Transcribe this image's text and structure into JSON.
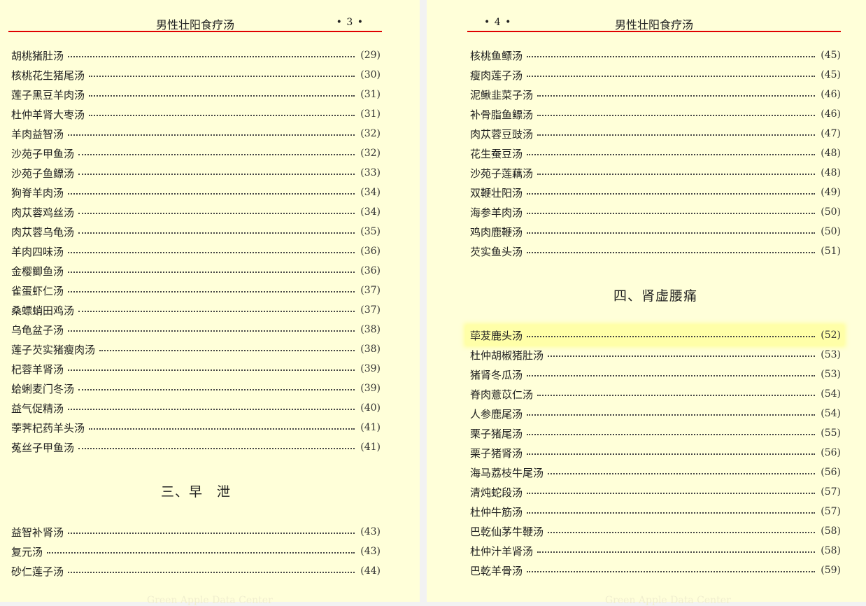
{
  "left_page": {
    "header_title": "男性壮阳食疗汤",
    "page_number": "• 3 •",
    "entries_a": [
      {
        "name": "胡桃猪肚汤",
        "page": "(29)"
      },
      {
        "name": "核桃花生猪尾汤",
        "page": "(30)"
      },
      {
        "name": "莲子黑豆羊肉汤",
        "page": "(31)"
      },
      {
        "name": "杜仲羊肾大枣汤",
        "page": "(31)"
      },
      {
        "name": "羊肉益智汤",
        "page": "(32)"
      },
      {
        "name": "沙苑子甲鱼汤",
        "page": "(32)"
      },
      {
        "name": "沙苑子鱼鳔汤",
        "page": "(33)"
      },
      {
        "name": "狗脊羊肉汤",
        "page": "(34)"
      },
      {
        "name": "肉苁蓉鸡丝汤",
        "page": "(34)"
      },
      {
        "name": "肉苁蓉乌龟汤",
        "page": "(35)"
      },
      {
        "name": "羊肉四味汤",
        "page": "(36)"
      },
      {
        "name": "金樱鲫鱼汤",
        "page": "(36)"
      },
      {
        "name": "雀蛋虾仁汤",
        "page": "(37)"
      },
      {
        "name": "桑螵蛸田鸡汤",
        "page": "(37)"
      },
      {
        "name": "乌龟盆子汤",
        "page": "(38)"
      },
      {
        "name": "莲子芡实猪瘦肉汤",
        "page": "(38)"
      },
      {
        "name": "杞蓉羊肾汤",
        "page": "(39)"
      },
      {
        "name": "蛤蜊麦门冬汤",
        "page": "(39)"
      },
      {
        "name": "益气促精汤",
        "page": "(40)"
      },
      {
        "name": "荸荠杞药羊头汤",
        "page": "(41)"
      },
      {
        "name": "菟丝子甲鱼汤",
        "page": "(41)"
      }
    ],
    "section_heading": "三、早　泄",
    "entries_b": [
      {
        "name": "益智补肾汤",
        "page": "(43)"
      },
      {
        "name": "复元汤",
        "page": "(43)"
      },
      {
        "name": "砂仁莲子汤",
        "page": "(44)"
      }
    ],
    "watermark": "Green Apple Data Center"
  },
  "right_page": {
    "header_title": "男性壮阳食疗汤",
    "page_number": "• 4 •",
    "entries_a": [
      {
        "name": "核桃鱼鳔汤",
        "page": "(45)"
      },
      {
        "name": "瘦肉莲子汤",
        "page": "(45)"
      },
      {
        "name": "泥鳅韭菜子汤",
        "page": "(46)"
      },
      {
        "name": "补骨脂鱼鳔汤",
        "page": "(46)"
      },
      {
        "name": "肉苁蓉豆豉汤",
        "page": "(47)"
      },
      {
        "name": "花生蚕豆汤",
        "page": "(48)"
      },
      {
        "name": "沙苑子莲藕汤",
        "page": "(48)"
      },
      {
        "name": "双鞭壮阳汤",
        "page": "(49)"
      },
      {
        "name": "海参羊肉汤",
        "page": "(50)"
      },
      {
        "name": "鸡肉鹿鞭汤",
        "page": "(50)"
      },
      {
        "name": "芡实鱼头汤",
        "page": "(51)"
      }
    ],
    "section_heading": "四、肾虚腰痛",
    "entries_b": [
      {
        "name": "荜茇鹿头汤",
        "page": "(52)"
      },
      {
        "name": "杜仲胡椒猪肚汤",
        "page": "(53)"
      },
      {
        "name": "猪肾冬瓜汤",
        "page": "(53)"
      },
      {
        "name": "脊肉薏苡仁汤",
        "page": "(54)"
      },
      {
        "name": "人参鹿尾汤",
        "page": "(54)"
      },
      {
        "name": "栗子猪尾汤",
        "page": "(55)"
      },
      {
        "name": "栗子猪肾汤",
        "page": "(56)"
      },
      {
        "name": "海马荔枝牛尾汤",
        "page": "(56)"
      },
      {
        "name": "清炖蛇段汤",
        "page": "(57)"
      },
      {
        "name": "杜仲牛筋汤",
        "page": "(57)"
      },
      {
        "name": "巴乾仙茅牛鞭汤",
        "page": "(58)"
      },
      {
        "name": "杜仲汁羊肾汤",
        "page": "(58)"
      },
      {
        "name": "巴乾羊骨汤",
        "page": "(59)"
      }
    ],
    "watermark": "Green Apple Data Center"
  },
  "colors": {
    "page_background": "#ffffd9",
    "header_rule": "#e00000",
    "highlight": "#ffffa8"
  }
}
